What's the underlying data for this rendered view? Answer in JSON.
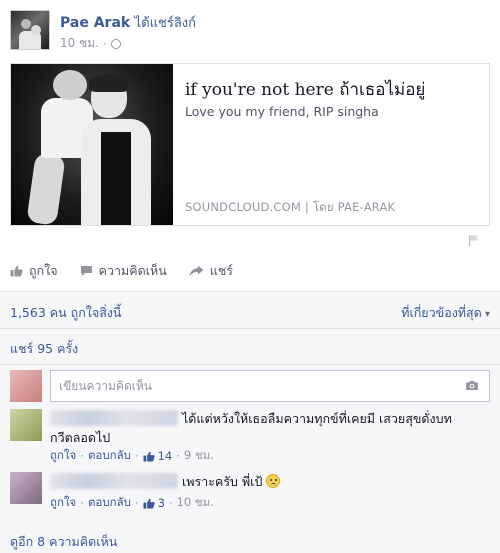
{
  "post": {
    "author": "Pae Arak",
    "action": "ได้แชร์ลิงก์",
    "time": "10 ชม.",
    "privacy_icon": "globe-icon"
  },
  "attachment": {
    "title": "if you're not here ถ้าเธอไม่อยู่",
    "description": "Love you my friend, RIP singha",
    "source": "SOUNDCLOUD.COM | โดย PAE-ARAK"
  },
  "actions": {
    "like": "ถูกใจ",
    "comment": "ความคิดเห็น",
    "share": "แชร์"
  },
  "ufi": {
    "likes": "1,563 คน ถูกใจสิ่งนี้",
    "sort": "ที่เกี่ยวข้องที่สุด",
    "shares": "แชร์ 95 ครั้ง",
    "comment_placeholder": "เขียนความคิดเห็น",
    "more_comments": "ดูอีก 8 ความคิดเห็น"
  },
  "comments": [
    {
      "text_line1": "ได้แต่หวังให้เธอลืมความทุกข์ที่เคยมี เสวยสุขดั่งบท",
      "text_line2": "กวีตลอดไป",
      "like": "ถูกใจ",
      "reply": "ตอบกลับ",
      "likes": "14",
      "time": "9 ชม."
    },
    {
      "text_line1": "เพราะครับ พี่เป้",
      "like": "ถูกใจ",
      "reply": "ตอบกลับ",
      "likes": "3",
      "time": "10 ชม."
    }
  ],
  "colors": {
    "link": "#3b5998",
    "meta": "#9197a3",
    "ufi_bg": "#f6f7f9"
  }
}
